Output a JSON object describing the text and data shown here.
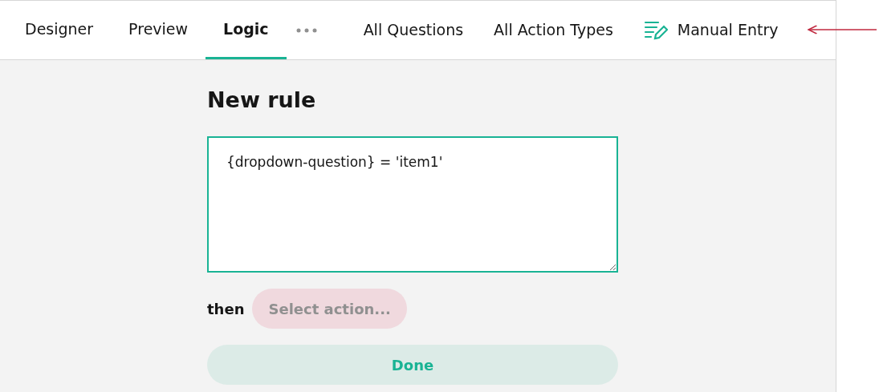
{
  "tabs": [
    {
      "label": "Designer",
      "selected": false
    },
    {
      "label": "Preview",
      "selected": false
    },
    {
      "label": "Logic",
      "selected": true
    }
  ],
  "toolbar": [
    {
      "label": "All Questions",
      "kind": "text"
    },
    {
      "label": "All Action Types",
      "kind": "text"
    },
    {
      "label": "Manual Entry",
      "kind": "icon"
    }
  ],
  "rule": {
    "title": "New rule",
    "expression": "{dropdown-question} = 'item1'",
    "then_label": "then",
    "action_placeholder": "Select action...",
    "done_label": "Done"
  }
}
